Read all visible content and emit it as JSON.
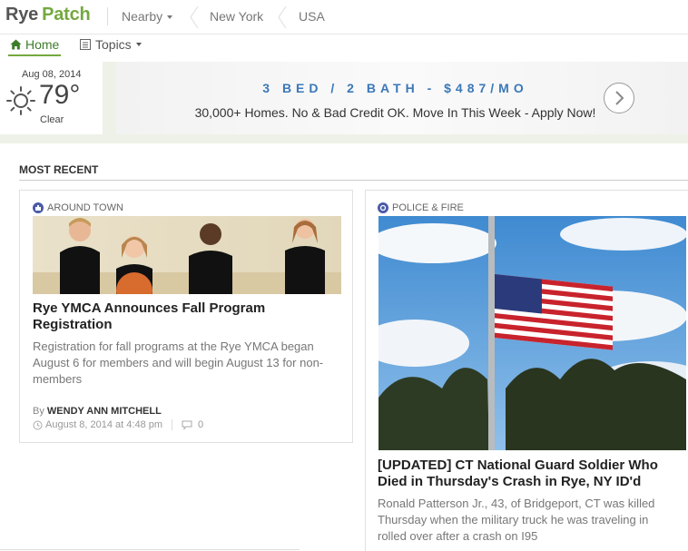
{
  "header": {
    "logo_first": "Rye",
    "logo_second": "Patch",
    "nearby_label": "Nearby",
    "breadcrumb": [
      "New York",
      "USA"
    ]
  },
  "subnav": {
    "home_label": "Home",
    "topics_label": "Topics"
  },
  "weather": {
    "date": "Aug 08, 2014",
    "temp": "79°",
    "condition": "Clear",
    "icon": "sun-icon"
  },
  "ad": {
    "headline": "3 BED / 2 BATH - $487/MO",
    "body": "30,000+ Homes. No & Bad Credit OK. Move In This Week - Apply Now!",
    "arrow_icon": "chevron-right-icon"
  },
  "section": {
    "title": "MOST RECENT"
  },
  "articles": [
    {
      "category": "AROUND TOWN",
      "category_icon": "town-icon",
      "title": "Rye YMCA Announces Fall Program Registration",
      "summary": "Registration for fall programs at the Rye YMCA began August 6 for members and will begin August 13 for non-members",
      "by": "By",
      "author": "WENDY ANN MITCHELL",
      "date": "August 8, 2014 at 4:48 pm",
      "comments": "0"
    },
    {
      "category": "POLICE & FIRE",
      "category_icon": "police-icon",
      "title": "[UPDATED] CT National Guard Soldier Who Died in Thursday's Crash in Rye, NY ID'd",
      "summary": "Ronald Patterson Jr., 43, of Bridgeport, CT was killed Thursday when the military truck he was traveling in rolled over after a crash on I95"
    }
  ],
  "colors": {
    "brand_green": "#74a83f",
    "ad_blue": "#3a78b8",
    "category_icon": "#4a5aa8"
  }
}
